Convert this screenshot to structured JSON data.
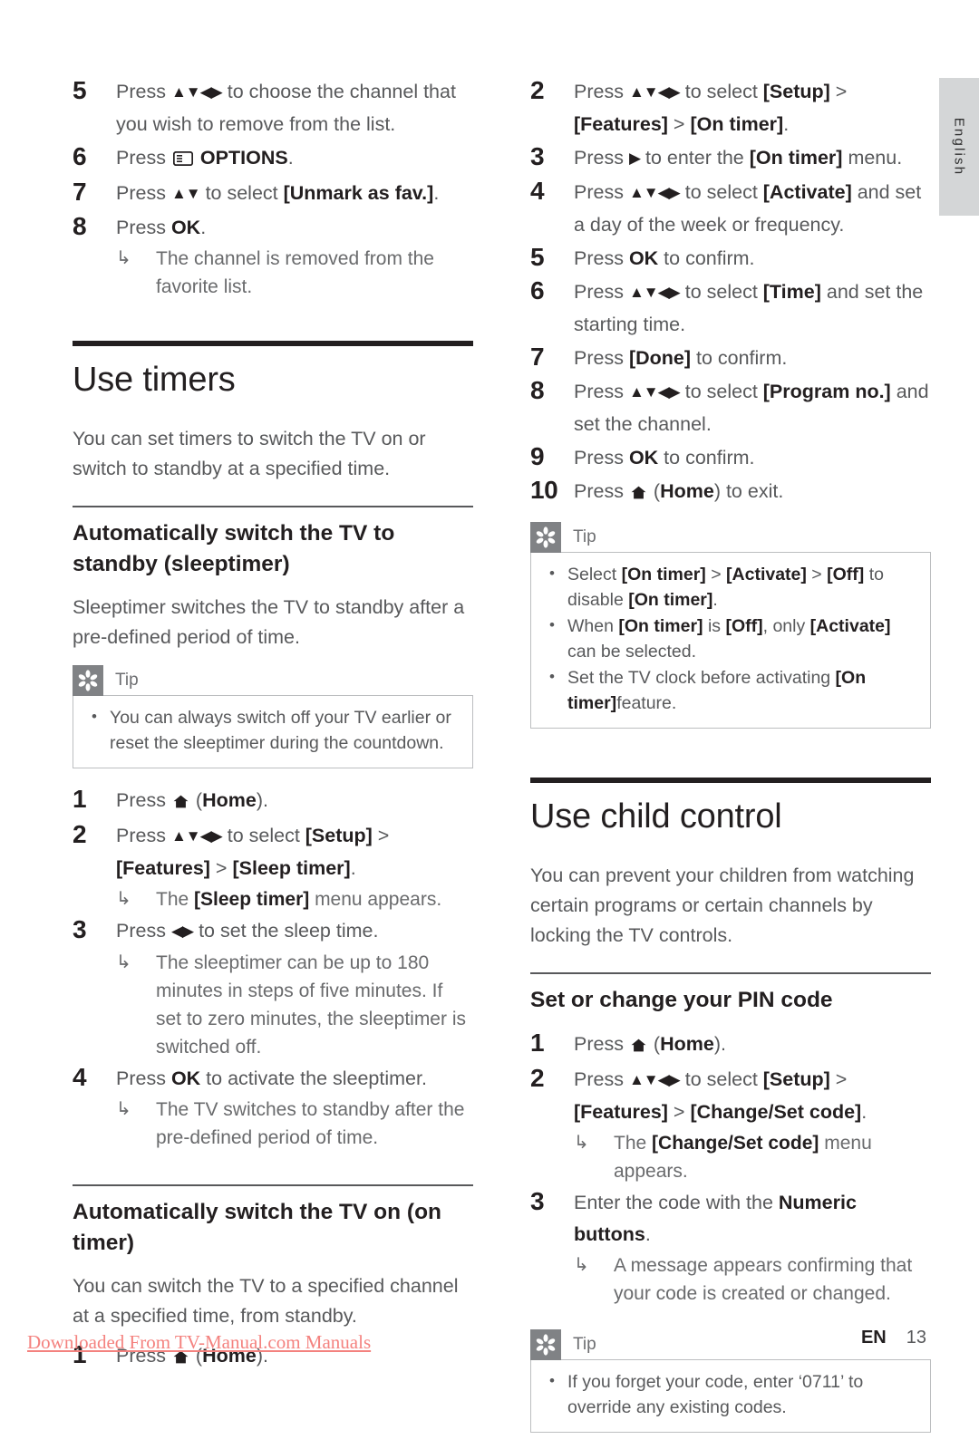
{
  "language_tab": {
    "label": "English"
  },
  "left_column": {
    "steps_top": [
      {
        "num": "5",
        "text_parts": [
          "Press ",
          "ARROWS4",
          " to choose the channel that you wish to remove from the list."
        ]
      },
      {
        "num": "6",
        "text_parts": [
          "Press ",
          "OPTIONS_ICON",
          " ",
          "OPTIONS",
          "."
        ]
      },
      {
        "num": "7",
        "text_parts": [
          "Press ",
          "ARROWS_UD",
          " to select ",
          "[Unmark as fav.]",
          "."
        ]
      },
      {
        "num": "8",
        "text_parts": [
          "Press ",
          "OK",
          "."
        ],
        "result": "The channel is removed from the favorite list."
      }
    ],
    "section": {
      "title": "Use timers",
      "intro": "You can set timers to switch the TV on or switch to standby at a specified time."
    },
    "sub1": {
      "title": "Automatically switch the TV to standby (sleeptimer)",
      "intro": "Sleeptimer switches the TV to standby after a pre-defined period of time.",
      "tip": {
        "label": "Tip",
        "items": [
          "You can always switch off your TV earlier or reset the sleeptimer during the countdown."
        ]
      },
      "steps": [
        {
          "num": "1",
          "text": "Press  (Home)."
        },
        {
          "num": "2",
          "text": "Press  to select [Setup] > [Features] > [Sleep timer].",
          "result": "The [Sleep timer] menu appears."
        },
        {
          "num": "3",
          "text": "Press  to set the sleep time.",
          "result": "The sleeptimer can be up to 180 minutes in steps of five minutes. If set to zero minutes, the sleeptimer is switched off."
        },
        {
          "num": "4",
          "text": "Press OK to activate the sleeptimer.",
          "result": "The TV switches to standby after the pre-defined period of time."
        }
      ]
    },
    "sub2": {
      "title": "Automatically switch the TV on (on timer)",
      "intro": "You can switch the TV to a specified channel at a specified time, from standby.",
      "steps": [
        {
          "num": "1",
          "text": "Press  (Home)."
        }
      ]
    }
  },
  "right_column": {
    "steps_top": [
      {
        "num": "2",
        "text": "Press  to select [Setup] > [Features] > [On timer]."
      },
      {
        "num": "3",
        "text": "Press  to enter the [On timer] menu."
      },
      {
        "num": "4",
        "text": "Press  to select [Activate] and set a day of the week or frequency."
      },
      {
        "num": "5",
        "text": "Press OK to confirm."
      },
      {
        "num": "6",
        "text": "Press  to select [Time] and set the starting time."
      },
      {
        "num": "7",
        "text": "Press [Done] to confirm."
      },
      {
        "num": "8",
        "text": "Press  to select [Program no.] and set the channel."
      },
      {
        "num": "9",
        "text": "Press OK to confirm."
      },
      {
        "num": "10",
        "text": "Press  (Home) to exit."
      }
    ],
    "tip": {
      "label": "Tip",
      "items": [
        "Select [On timer] > [Activate] > [Off] to disable [On timer].",
        "When [On timer] is [Off], only [Activate] can be selected.",
        "Set the TV clock before activating [On timer]feature."
      ]
    },
    "section": {
      "title": "Use child control",
      "intro": "You can prevent your children from watching certain programs or certain channels by locking the TV controls."
    },
    "sub1": {
      "title": "Set or change your PIN code",
      "steps": [
        {
          "num": "1",
          "text": "Press  (Home)."
        },
        {
          "num": "2",
          "text": "Press  to select [Setup] > [Features] > [Change/Set code].",
          "result": "The [Change/Set code] menu appears."
        },
        {
          "num": "3",
          "text": "Enter the code with the Numeric buttons.",
          "result": "A message appears confirming that your code is created or changed."
        }
      ],
      "tip": {
        "label": "Tip",
        "items": [
          "If you forget your code, enter ‘0711’ to override any existing codes."
        ]
      }
    }
  },
  "footer": {
    "lang_code": "EN",
    "page_number": "13",
    "watermark": "Downloaded From TV-Manual.com Manuals"
  },
  "labels": {
    "step5_a": "Press ",
    "step5_b": " to choose the channel that you wish to remove from the list.",
    "step6_a": "Press ",
    "step6_options": "OPTIONS",
    "step6_end": ".",
    "step7_a": "Press ",
    "step7_b": " to select ",
    "step7_c": "[Unmark as fav.]",
    "step7_d": ".",
    "step8_a": "Press ",
    "step8_ok": "OK",
    "step8_d": ".",
    "step8_result": "The channel is removed from the favorite list.",
    "press": "Press ",
    "home_word": "Home",
    "to_select": " to select ",
    "setup": "[Setup]",
    "gt": " > ",
    "features": "[Features]",
    "sleep_timer": "[Sleep timer]",
    "on_timer": "[On timer]",
    "change_set_code": "[Change/Set code]",
    "period": ".",
    "the": "The ",
    "menu_appears": " menu appears.",
    "set_sleep_time": " to set the sleep time.",
    "sleeptimer_result": "The sleeptimer can be up to 180 minutes in steps of five minutes. If set to zero minutes, the sleeptimer is switched off.",
    "press_ok_activate_a": "Press ",
    "ok": "OK",
    "activate_sleeptimer": " to activate the sleeptimer.",
    "standby_result": "The TV switches to standby after the pre-defined period of time.",
    "to_enter_the": " to enter the ",
    "menu_word": " menu.",
    "activate": "[Activate]",
    "and_set_day": " and set a day of the week or frequency.",
    "to_confirm": " to confirm.",
    "time_key": "[Time]",
    "and_set_starting": " and set the starting time.",
    "done": "[Done]",
    "program_no": "[Program no.]",
    "and_set_channel": " and set the channel.",
    "to_exit": " to exit.",
    "enter_code_a": "Enter the code with the ",
    "numeric_buttons": "Numeric buttons",
    "message_result": "A message appears confirming that your code is created or changed.",
    "off": "[Off]",
    "tip_on_a": "Select ",
    "tip_on_b": " to disable ",
    "tip_on2_a": "When ",
    "tip_on2_is": " is ",
    "tip_on2_only": ", only ",
    "tip_on2_can": " can be selected.",
    "tip_on3_a": "Set the TV clock before activating ",
    "tip_on3_b": "feature."
  }
}
